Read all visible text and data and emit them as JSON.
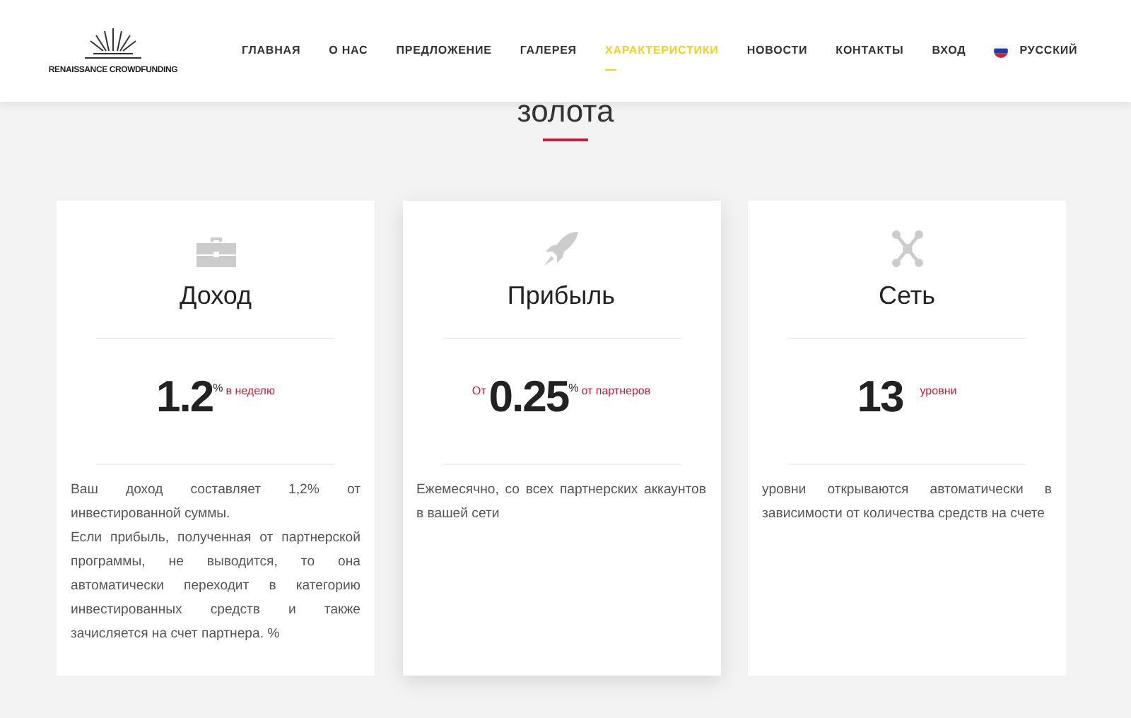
{
  "logo": {
    "text": "RENAISSANCE CROWDFUNDING"
  },
  "nav": [
    {
      "label": "ГЛАВНАЯ",
      "selected": false
    },
    {
      "label": "О НАС",
      "selected": false
    },
    {
      "label": "ПРЕДЛОЖЕНИЕ",
      "selected": false
    },
    {
      "label": "ГАЛЕРЕЯ",
      "selected": false
    },
    {
      "label": "ХАРАКТЕРИСТИКИ",
      "selected": true
    },
    {
      "label": "НОВОСТИ",
      "selected": false
    },
    {
      "label": "КОНТАКТЫ",
      "selected": false
    },
    {
      "label": "ВХОД",
      "selected": false
    }
  ],
  "language": {
    "label": "РУССКИЙ"
  },
  "section_title": "золота",
  "cards": [
    {
      "title": "Доход",
      "featured": false,
      "value": "1.2",
      "unit": "%",
      "suffix": "в неделю",
      "paragraphs": [
        "Ваш доход составляет 1,2% от инвестированной суммы.",
        "Если прибыль, полученная от партнерской программы, не выводится, то она автоматически переходит в категорию инвестированных средств и также зачисляется на счет партнера. %"
      ]
    },
    {
      "title": "Прибыль",
      "featured": true,
      "prefix": "От",
      "value": "0.25",
      "unit": "%",
      "suffix": "от партнеров",
      "paragraphs": [
        "Ежемесячно, со всех партнерских аккаунтов в вашей сети"
      ]
    },
    {
      "title": "Сеть",
      "featured": false,
      "value": "13",
      "suffix": "уровни",
      "paragraphs": [
        "уровни открываются автоматически в зависимости от количества средств на счете"
      ]
    }
  ]
}
